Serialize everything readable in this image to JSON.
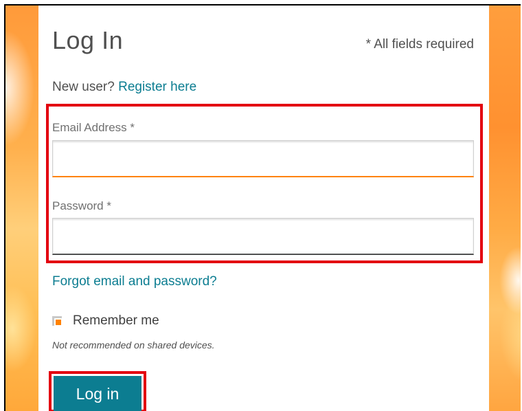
{
  "page": {
    "title": "Log In",
    "required_note": "* All fields required"
  },
  "register": {
    "prompt": "New user?",
    "link_text": "Register here"
  },
  "fields": {
    "email": {
      "label": "Email Address *",
      "value": "",
      "placeholder": ""
    },
    "password": {
      "label": "Password *",
      "value": "",
      "placeholder": ""
    }
  },
  "forgot_link": "Forgot email and password?",
  "remember": {
    "label": "Remember me",
    "checked": true,
    "hint": "Not recommended on shared devices."
  },
  "submit": {
    "label": "Log in"
  },
  "colors": {
    "accent": "#0c7d91",
    "highlight": "#e3000f",
    "focus_underline": "#ff8200",
    "background_gradient": "#ff9a3a"
  }
}
